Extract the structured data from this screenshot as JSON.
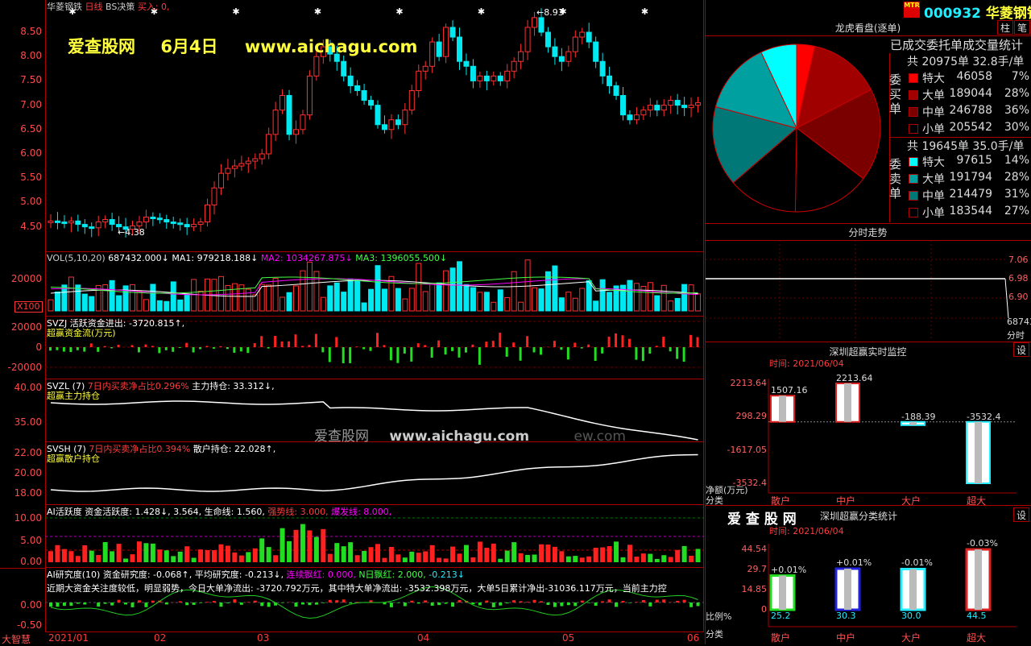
{
  "stock": {
    "name": "华菱钢铁",
    "code": "000932",
    "period": "日线",
    "strategy": "BS决策",
    "buy_label": "买入: 0,",
    "mtr": "MTR"
  },
  "watermark": {
    "site": "爱查股网",
    "date": "6月4日",
    "url": "www.aichagu.com",
    "mid_site": "爱查股网",
    "mid_url": "www.aichagu.com",
    "mid_tail": "ew.com"
  },
  "price_axis": [
    "8.50",
    "8.00",
    "7.50",
    "7.00",
    "6.50",
    "6.00",
    "5.50",
    "5.00",
    "4.50"
  ],
  "price_marks": {
    "high": "8.93",
    "low": "4.38"
  },
  "volume": {
    "header": "VOL(5,10,20)",
    "vol": "687432.000↓",
    "ma1": "MA1: 979218.188↓",
    "ma2": "MA2: 1034267.875↓",
    "ma3": "MA3: 1396055.500↓",
    "axis": [
      "20000"
    ],
    "unit": "X100"
  },
  "svzj": {
    "header": "SVZJ  活跃资金进出: -3720.815↑,",
    "sub": "超赢资金流(万元)",
    "axis": [
      "20000",
      "0",
      "-20000"
    ]
  },
  "svzl": {
    "header": "SVZL (7)",
    "ratio": "7日内买卖净占比0.296%",
    "hold": "主力持仓: 33.312↓,",
    "sub": "超赢主力持仓",
    "axis": [
      "40.00",
      "35.00"
    ]
  },
  "svsh": {
    "header": "SVSH (7)",
    "ratio": "7日内买卖净占比0.394%",
    "hold": "散户持仓: 22.028↑,",
    "sub": "超赢散户持仓",
    "axis": [
      "22.00",
      "20.00",
      "18.00"
    ]
  },
  "ai_active": {
    "header": "AI活跃度 资金活跃度: 1.428↓,",
    "v2": "3.564,",
    "life": "生命线: 1.560,",
    "strong": "强势线: 3.000,",
    "burst": "爆发线: 8.000,",
    "axis": [
      "10.00",
      "5.00",
      "0.00"
    ]
  },
  "ai_research": {
    "header": "AI研究度(10) 资金研究度: -0.068↑,",
    "avg": "平均研究度: -0.213↓,",
    "streak": "连续飘红: 0.000,",
    "n": "N日飘红: 2.000,",
    "last": "-0.213↓",
    "text": "近期大资金关注度较低，明显弱势，今日大单净流出: -3720.792万元，其中特大单净流出: -3532.398万元，大单5日累计净出-31036.117万元，当前主力控",
    "axis": [
      "0.00",
      "-0.50"
    ]
  },
  "x_axis": [
    "2021/01",
    "02",
    "03",
    "04",
    "05",
    "06"
  ],
  "bottom_label": "大智慧",
  "right_tabs": [
    "柱",
    "笔"
  ],
  "longhu": {
    "title": "龙虎看盘(逐单)",
    "stat_title": "已成交委托单成交量统计",
    "buy_label": "委买单",
    "sell_label": "委卖单",
    "buy_total": "共 20975单 32.8手/单",
    "sell_total": "共 19645单 35.0手/单",
    "buy_rows": [
      {
        "name": "特大",
        "vol": "46058",
        "pct": "7%",
        "color": "#ff0000"
      },
      {
        "name": "大单",
        "vol": "189044",
        "pct": "28%",
        "color": "#a00000"
      },
      {
        "name": "中单",
        "vol": "246788",
        "pct": "36%",
        "color": "#7a0000"
      },
      {
        "name": "小单",
        "vol": "205542",
        "pct": "30%",
        "color": "#000000"
      }
    ],
    "sell_rows": [
      {
        "name": "特大",
        "vol": "97615",
        "pct": "14%",
        "color": "#00ffff"
      },
      {
        "name": "大单",
        "vol": "191794",
        "pct": "28%",
        "color": "#00a0a0"
      },
      {
        "name": "中单",
        "vol": "214479",
        "pct": "31%",
        "color": "#007878"
      },
      {
        "name": "小单",
        "vol": "183544",
        "pct": "27%",
        "color": "#000000"
      }
    ]
  },
  "fenshi": {
    "title": "分时走势",
    "axis": [
      "7.06",
      "6.98",
      "6.90"
    ],
    "vol": "68743",
    "label": "分时"
  },
  "realtime": {
    "title": "深圳超赢实时监控",
    "settings": "设",
    "time": "时间: 2021/06/04",
    "y_axis": [
      "2213.64",
      "298.29",
      "-1617.05",
      "-3532.4"
    ],
    "values": [
      "1507.16",
      "2213.64",
      "-188.39",
      "-3532.4"
    ],
    "net_label": "净额(万元)",
    "cat_label": "分类",
    "cats": [
      "散户",
      "中户",
      "大户",
      "超大"
    ]
  },
  "classify": {
    "title": "深圳超赢分类统计",
    "settings": "设",
    "time": "时间: 2021/06/04",
    "brand": "爱 查 股 网",
    "y_axis": [
      "44.54",
      "29.7",
      "14.85",
      "0"
    ],
    "changes": [
      "+0.01%",
      "+0.01%",
      "-0.01%",
      "-0.03%"
    ],
    "values": [
      "25.2",
      "30.3",
      "30.0",
      "44.5"
    ],
    "ratio_label": "比例%",
    "cat_label": "分类",
    "cats": [
      "散户",
      "中户",
      "大户",
      "超大"
    ]
  }
}
